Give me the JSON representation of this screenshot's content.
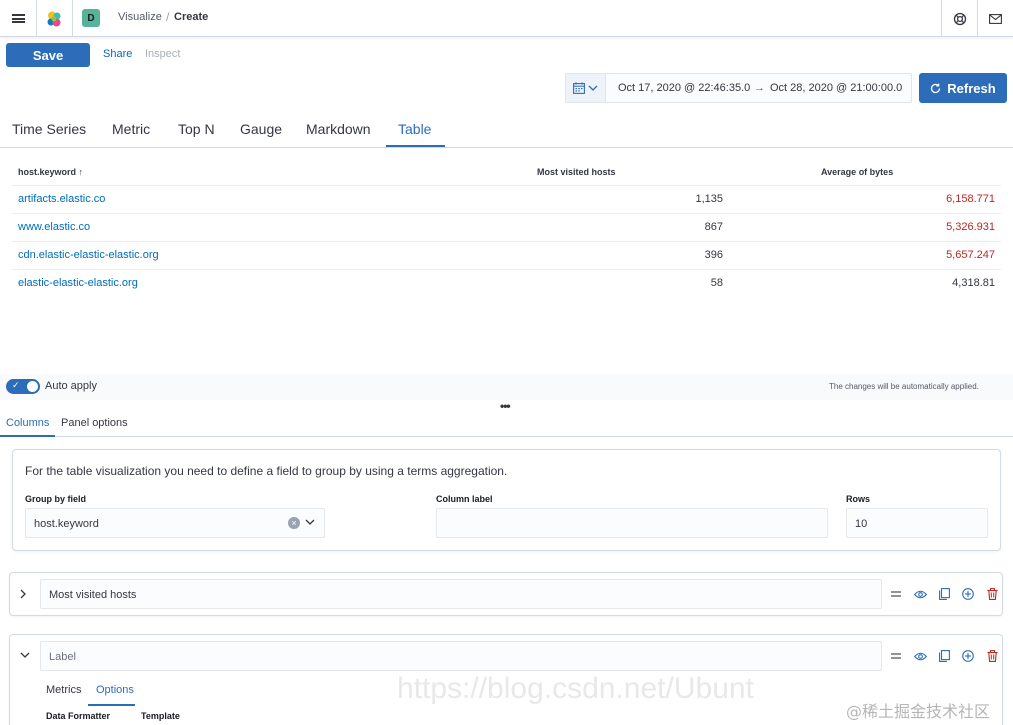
{
  "header": {
    "space_initial": "D",
    "breadcrumb_parent": "Visualize",
    "breadcrumb_separator": "/",
    "breadcrumb_current": "Create"
  },
  "toolbar": {
    "save_label": "Save",
    "share_label": "Share",
    "inspect_label": "Inspect"
  },
  "time": {
    "start": "Oct 17, 2020 @ 22:46:35.0",
    "arrow": "→",
    "end": "Oct 28, 2020 @ 21:00:00.0",
    "refresh_label": "Refresh"
  },
  "vis_tabs": [
    "Time Series",
    "Metric",
    "Top N",
    "Gauge",
    "Markdown",
    "Table"
  ],
  "active_vis_tab": "Table",
  "table": {
    "headers": [
      "host.keyword",
      "Most visited hosts",
      "Average of bytes"
    ],
    "sort_indicator": "↑",
    "rows": [
      {
        "host": "artifacts.elastic.co",
        "visits": "1,135",
        "avg_bytes": "6,158.771",
        "avg_highlight": true
      },
      {
        "host": "www.elastic.co",
        "visits": "867",
        "avg_bytes": "5,326.931",
        "avg_highlight": true
      },
      {
        "host": "cdn.elastic-elastic-elastic.org",
        "visits": "396",
        "avg_bytes": "5,657.247",
        "avg_highlight": true
      },
      {
        "host": "elastic-elastic-elastic.org",
        "visits": "58",
        "avg_bytes": "4,318.81",
        "avg_highlight": false
      }
    ],
    "highlight_color": "#bd271e"
  },
  "editor": {
    "auto_apply_label": "Auto apply",
    "auto_apply_on": true,
    "auto_apply_note": "The changes will be automatically applied.",
    "tabs": [
      "Columns",
      "Panel options"
    ],
    "active_tab": "Columns",
    "description": "For the table visualization you need to define a field to group by using a terms aggregation.",
    "group_by_label": "Group by field",
    "group_by_value": "host.keyword",
    "column_label_label": "Column label",
    "column_label_value": "",
    "rows_label": "Rows",
    "rows_value": "10",
    "aggregations": [
      {
        "label": "Most visited hosts",
        "expanded": false
      },
      {
        "label": "Label",
        "expanded": true
      }
    ],
    "sub_tabs": [
      "Metrics",
      "Options"
    ],
    "active_sub_tab": "Options",
    "sub_fields": [
      "Data Formatter",
      "Template"
    ]
  },
  "watermark": {
    "url_text": "https://blog.csdn.net/Ubunt",
    "site_text": "@稀土掘金技术社区"
  },
  "colors": {
    "accent": "#2c6cb8",
    "link": "#006bb8",
    "danger": "#bd271e"
  }
}
